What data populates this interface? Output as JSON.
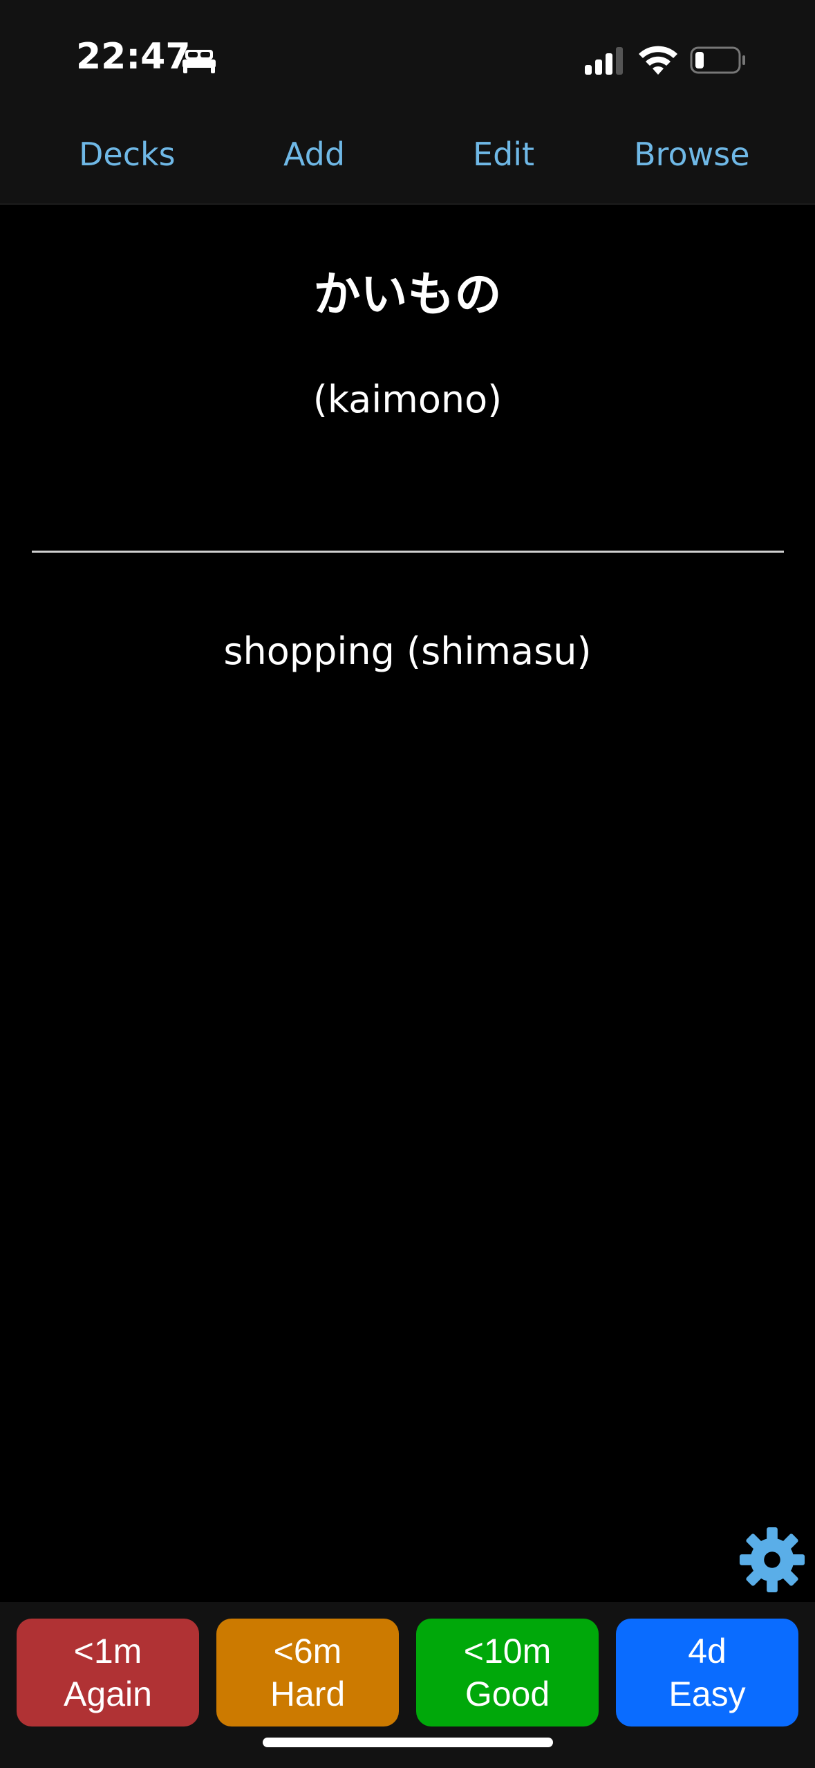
{
  "status_bar": {
    "time": "22:47",
    "icons": [
      "bed-icon",
      "signal-icon",
      "wifi-icon",
      "battery-icon"
    ]
  },
  "nav": {
    "decks": "Decks",
    "add": "Add",
    "edit": "Edit",
    "browse": "Browse",
    "color": "#6fb8e6"
  },
  "card": {
    "front": "かいもの",
    "reading": "(kaimono)",
    "back": "shopping (shimasu)"
  },
  "answers": [
    {
      "interval": "<1m",
      "label": "Again",
      "color": "#b03234"
    },
    {
      "interval": "<6m",
      "label": "Hard",
      "color": "#cc7a00"
    },
    {
      "interval": "<10m",
      "label": "Good",
      "color": "#00a80a"
    },
    {
      "interval": "4d",
      "label": "Easy",
      "color": "#0a6cff"
    }
  ],
  "settings_icon": "gear-icon"
}
